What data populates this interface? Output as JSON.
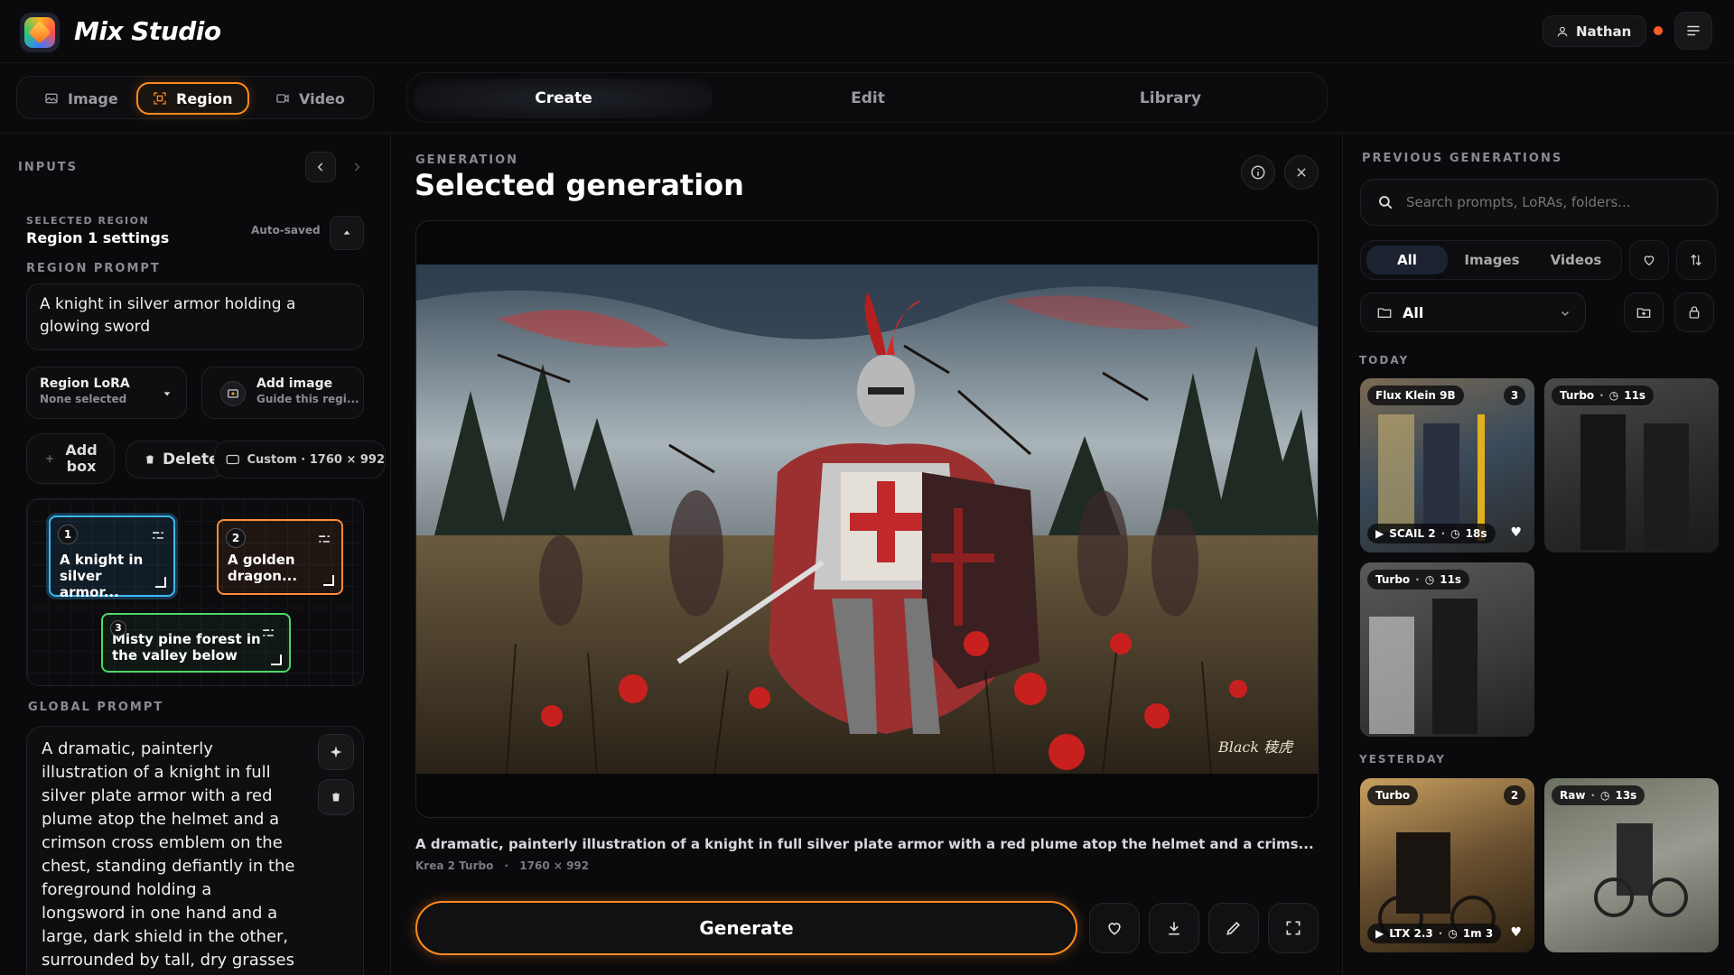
{
  "app": {
    "title": "Mix Studio"
  },
  "user": {
    "name": "Nathan"
  },
  "modes": [
    {
      "label": "Image",
      "active": false
    },
    {
      "label": "Region",
      "active": true
    },
    {
      "label": "Video",
      "active": false
    }
  ],
  "tabs": [
    {
      "label": "Create",
      "active": true
    },
    {
      "label": "Edit",
      "active": false
    },
    {
      "label": "Library",
      "active": false
    }
  ],
  "left": {
    "inputs_label": "INPUTS",
    "selected_region_label": "SELECTED REGION",
    "region_title": "Region 1 settings",
    "autosave": "Auto-saved",
    "region_prompt_label": "REGION PROMPT",
    "region_prompt": "A knight in silver armor holding a glowing sword",
    "lora": {
      "title": "Region LoRA",
      "sub": "None selected"
    },
    "add_image": {
      "title": "Add image",
      "sub": "Guide this regi..."
    },
    "add_box": "Add box",
    "delete": "Delete",
    "canvas_size": "Custom · 1760 × 992",
    "regions": [
      {
        "num": "1",
        "text": "A knight in silver armor...",
        "color": "#3ab8ff"
      },
      {
        "num": "2",
        "text": "A golden dragon...",
        "color": "#ff8a3a"
      },
      {
        "num": "3",
        "text": "Misty pine forest in the valley below",
        "color": "#4cd964"
      }
    ],
    "global_prompt_label": "GLOBAL PROMPT",
    "global_prompt": "A dramatic, painterly illustration of a knight in full silver plate armor with a red plume atop the helmet and a crimson cross emblem on the chest, standing defiantly in the foreground holding a longsword in one hand and a large, dark shield in the other, surrounded by tall, dry grasses and scattered red"
  },
  "center": {
    "section_label": "GENERATION",
    "title": "Selected generation",
    "caption": "A dramatic, painterly illustration of a knight in full silver plate armor with a red plume atop the helmet and a crims...",
    "model": "Krea 2 Turbo",
    "size": "1760 × 992",
    "generate_label": "Generate",
    "signature": "Black 稜虎"
  },
  "right": {
    "section_label": "PREVIOUS GENERATIONS",
    "search_placeholder": "Search prompts, LoRAs, folders...",
    "filters": [
      {
        "label": "All",
        "active": true
      },
      {
        "label": "Images",
        "active": false
      },
      {
        "label": "Videos",
        "active": false
      }
    ],
    "folder": "All",
    "today_label": "TODAY",
    "yesterday_label": "YESTERDAY",
    "today": [
      {
        "model": "Flux Klein 9B",
        "count": "3",
        "bottom": "SCAIL 2",
        "time": "18s",
        "liked": true
      },
      {
        "model": "Turbo",
        "time": "11s"
      },
      {
        "model": "Turbo",
        "time": "11s"
      }
    ],
    "yesterday": [
      {
        "model": "Turbo",
        "count": "2",
        "bottom": "LTX 2.3",
        "time": "1m 3",
        "liked": true
      },
      {
        "model": "Raw",
        "time": "13s"
      }
    ]
  },
  "colors": {
    "accent": "#ff8a1f",
    "background": "#0a0a0c"
  }
}
